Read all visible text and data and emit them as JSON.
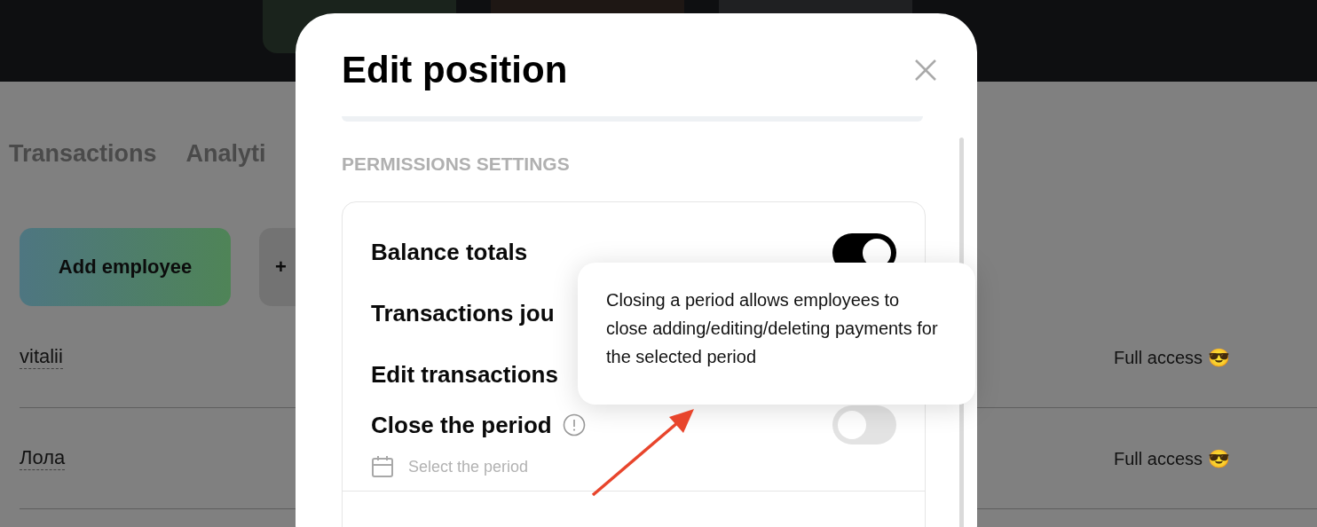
{
  "top_bar": {
    "buttons": [
      {
        "kind": "green"
      },
      {
        "kind": "brown"
      },
      {
        "kind": "grey"
      }
    ]
  },
  "tabs": [
    {
      "label": "Transactions"
    },
    {
      "label": "Analyti"
    }
  ],
  "actions": [
    {
      "label": "Add employee",
      "kind": "primary"
    },
    {
      "label": "+",
      "kind": "secondary"
    }
  ],
  "employees": [
    {
      "name": "vitalii",
      "access": "Full access 😎"
    },
    {
      "name": "Лола",
      "access": "Full access 😎"
    }
  ],
  "modal": {
    "title": "Edit position",
    "section_title": "PERMISSIONS SETTINGS",
    "permissions": [
      {
        "label": "Balance totals",
        "on": true
      },
      {
        "label": "Transactions jou"
      },
      {
        "label": "Edit transactions"
      },
      {
        "label": "Close the period",
        "on": false,
        "info": true,
        "period_placeholder": "Select the period"
      }
    ],
    "tooltip": "Closing a period allows employees to close adding/editing/deleting payments for the selected period"
  }
}
